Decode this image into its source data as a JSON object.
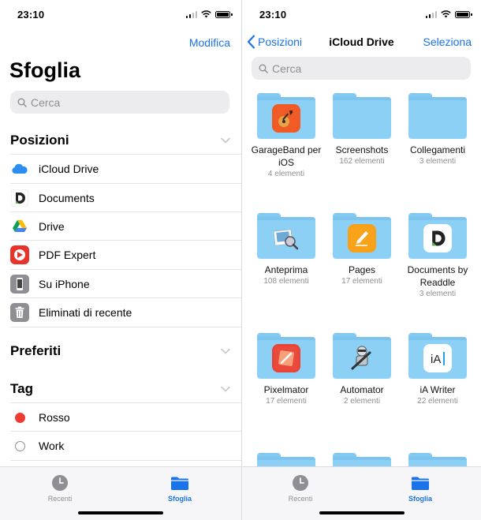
{
  "left": {
    "time": "23:10",
    "edit_label": "Modifica",
    "title": "Sfoglia",
    "search_placeholder": "Cerca",
    "locations_title": "Posizioni",
    "locations": [
      {
        "label": "iCloud Drive",
        "icon": "icloud-icon"
      },
      {
        "label": "Documents",
        "icon": "documents-app-icon"
      },
      {
        "label": "Drive",
        "icon": "google-drive-icon"
      },
      {
        "label": "PDF Expert",
        "icon": "pdf-expert-icon"
      },
      {
        "label": "Su iPhone",
        "icon": "iphone-icon"
      },
      {
        "label": "Eliminati di recente",
        "icon": "trash-icon"
      }
    ],
    "favorites_title": "Preferiti",
    "tags_title": "Tag",
    "tags": [
      {
        "label": "Rosso",
        "color": "#ee3b33"
      },
      {
        "label": "Work",
        "color": ""
      }
    ]
  },
  "right": {
    "time": "23:10",
    "back_label": "Posizioni",
    "title": "iCloud Drive",
    "select_label": "Seleziona",
    "search_placeholder": "Cerca",
    "folders": [
      {
        "name": "GarageBand per iOS",
        "count": "4 elementi",
        "icon": "garageband-icon"
      },
      {
        "name": "Screenshots",
        "count": "162 elementi",
        "icon": ""
      },
      {
        "name": "Collegamenti",
        "count": "3 elementi",
        "icon": ""
      },
      {
        "name": "Anteprima",
        "count": "108 elementi",
        "icon": "preview-icon"
      },
      {
        "name": "Pages",
        "count": "17 elementi",
        "icon": "pages-icon"
      },
      {
        "name": "Documents by Readdle",
        "count": "3 elementi",
        "icon": "documents-app-icon"
      },
      {
        "name": "Pixelmator",
        "count": "17 elementi",
        "icon": "pixelmator-icon"
      },
      {
        "name": "Automator",
        "count": "2 elementi",
        "icon": "automator-icon"
      },
      {
        "name": "iA Writer",
        "count": "22 elementi",
        "icon": "ia-writer-icon"
      }
    ]
  },
  "tabbar": {
    "recents_label": "Recenti",
    "browse_label": "Sfoglia"
  },
  "colors": {
    "accent": "#1a73e8",
    "folder": "#8cd0f6",
    "tag_red": "#ee3b33"
  }
}
